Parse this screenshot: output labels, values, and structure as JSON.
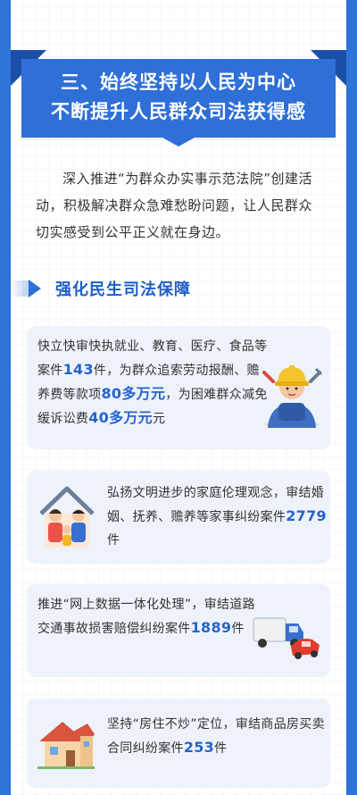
{
  "title": {
    "line1": "三、始终坚持以人民为中心",
    "line2": "不断提升人民群众司法获得感"
  },
  "intro": "深入推进“为群众办实事示范法院”创建活动，积极解决群众急难愁盼问题，让人民群众切实感受到公平正义就在身边。",
  "section": {
    "label": "强化民生司法保障"
  },
  "cards": [
    {
      "t1": "快立快审快执就业、教育、医疗、食品等案件",
      "n1": "143",
      "t2": "件，为群众追索劳动报酬、赡养费等款项",
      "n2": "80多万元",
      "t3": "，为困难群众减免缓诉讼费",
      "n3": "40多万元",
      "t4": "元"
    },
    {
      "t1": "弘扬文明进步的家庭伦理观念，审结婚姻、抚养、赡养等家事纠纷案件",
      "n1": "2779",
      "t2": "件"
    },
    {
      "t1": "推进“网上数据一体化处理”，审结道路交通事故损害赔偿纠纷案件",
      "n1": "1889",
      "t2": "件"
    },
    {
      "t1": "坚持“房住不炒”定位，审结商品房买卖合同纠纷案件",
      "n1": "253",
      "t2": "件"
    }
  ],
  "icons": [
    "worker-icon",
    "family-house-icon",
    "car-accident-icon",
    "house-icon"
  ],
  "colors": {
    "page_bg": "#2f74d6",
    "accent": "#2e6fd8",
    "highlight": "#2663cc",
    "card_bg": "#eef3fb"
  }
}
